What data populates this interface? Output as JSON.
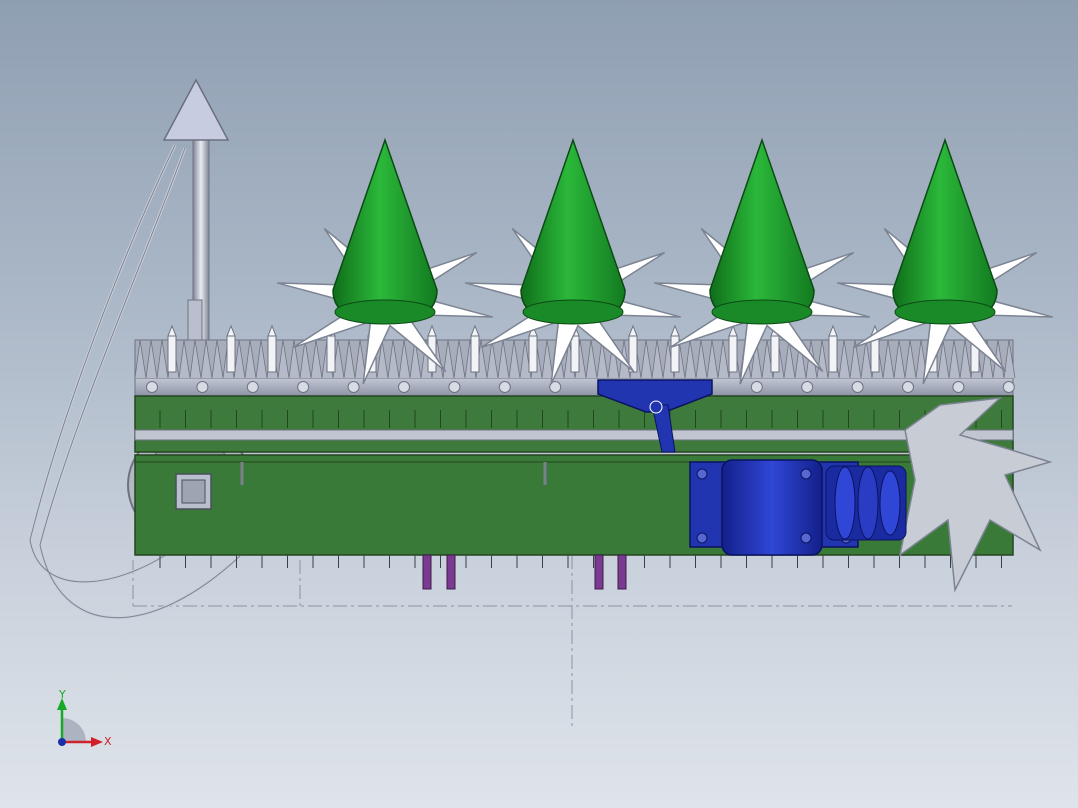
{
  "triad": {
    "x_label": "X",
    "y_label": "Y"
  },
  "colors": {
    "frame_green": "#3d7a3b",
    "cone_green": "#1f9a2c",
    "motor_blue": "#1c2fa8",
    "bracket_blue": "#2235b0",
    "rail_grey": "#a6adbd",
    "star_white": "#ffffff",
    "pin_purple": "#7a3a8f"
  },
  "assembly": {
    "cone_count": 4,
    "star_wheel_count": 4
  }
}
